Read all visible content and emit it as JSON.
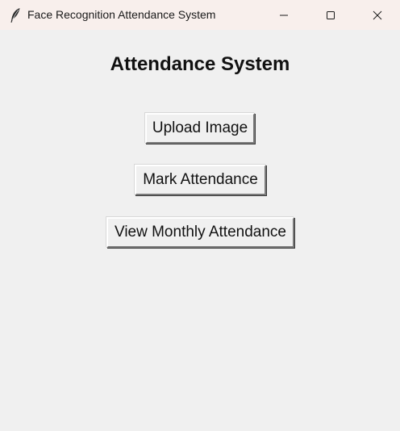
{
  "window": {
    "title": "Face Recognition Attendance System",
    "app_icon": "feather-icon",
    "controls": [
      "minimize-icon",
      "maximize-icon",
      "close-icon"
    ]
  },
  "main": {
    "heading": "Attendance System",
    "buttons": [
      {
        "label": "Upload Image"
      },
      {
        "label": "Mark Attendance"
      },
      {
        "label": "View Monthly Attendance"
      }
    ]
  },
  "colors": {
    "background": "#f0f0f0",
    "titlebar": "#f8efec"
  }
}
